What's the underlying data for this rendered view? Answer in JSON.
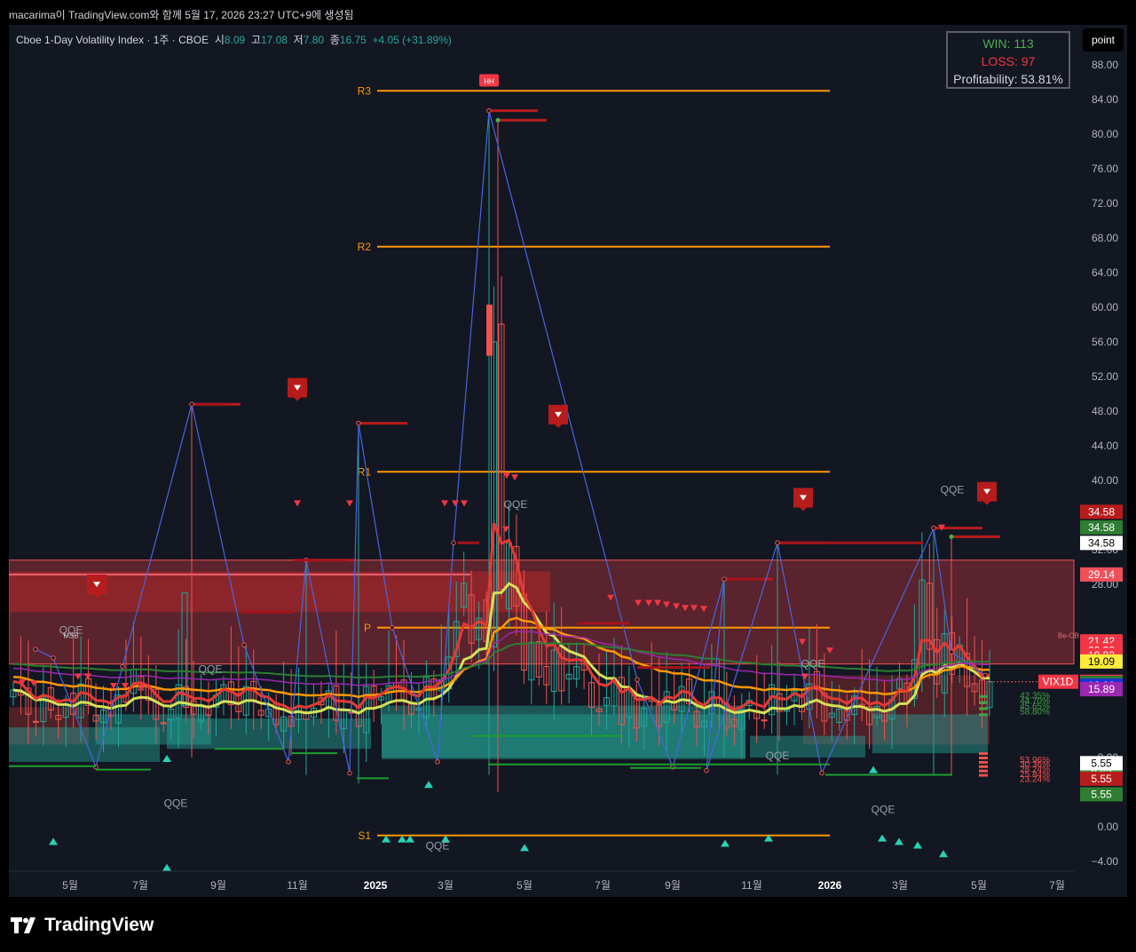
{
  "header": {
    "snapshot_text": "macarima이 TradingView.com와 함께 5월 17, 2026 23:27 UTC+9에 생성됨"
  },
  "legend": {
    "symbol": "Cboe 1-Day Volatility Index · 1주 · CBOE",
    "open_label": "시",
    "open": "8.09",
    "high_label": "고",
    "high": "17.08",
    "low_label": "저",
    "low": "7.80",
    "close_label": "종",
    "close": "16.75",
    "change": "+4.05 (+31.89%)"
  },
  "stats_box": {
    "win": "WIN: 113",
    "loss": "LOSS: 97",
    "profitability": "Profitability: 53.81%"
  },
  "point_button": "point",
  "footer": {
    "brand": "TradingView"
  },
  "colors": {
    "background": "#131722",
    "up": "#26a69a",
    "down": "#ef5350",
    "pivot": "#ff9800",
    "zone": "#b2333c"
  },
  "chart_data": {
    "type": "candlestick",
    "title": "Cboe 1-Day Volatility Index",
    "interval": "1주",
    "y_ticks": [
      "88.00",
      "84.00",
      "80.00",
      "76.00",
      "72.00",
      "68.00",
      "64.00",
      "60.00",
      "56.00",
      "52.00",
      "48.00",
      "44.00",
      "40.00",
      "32.00",
      "28.00",
      "8.00",
      "0.00",
      "−4.00"
    ],
    "y_range": [
      -4.5,
      94
    ],
    "x_ticks": [
      "5월",
      "7월",
      "9월",
      "11월",
      "2025",
      "3월",
      "5월",
      "7월",
      "9월",
      "11월",
      "2026",
      "3월",
      "5월",
      "7월"
    ],
    "pivot_levels": [
      {
        "label": "R3",
        "value": 85.0
      },
      {
        "label": "R2",
        "value": 67.0
      },
      {
        "label": "R1",
        "value": 41.0
      },
      {
        "label": "P",
        "value": 23.0
      },
      {
        "label": "S1",
        "value": -1.0
      }
    ],
    "price_badges": [
      {
        "text": "34.58",
        "bg": "#b71c1c",
        "fg": "#ffffff"
      },
      {
        "text": "34.58",
        "bg": "#2e7d32",
        "fg": "#ffffff"
      },
      {
        "text": "34.58",
        "bg": "#ffffff",
        "fg": "#000000"
      },
      {
        "text": "29.14",
        "bg": "#f0505a",
        "fg": "#ffffff"
      },
      {
        "text": "21.42",
        "bg": "#f23645",
        "fg": "#ffffff"
      },
      {
        "text": "20.38",
        "bg": "#f23645",
        "fg": "#ffffff"
      },
      {
        "text": "19.82",
        "bg": "#f23645",
        "fg": "#ffffff"
      },
      {
        "text": "19.09",
        "bg": "#ffeb3b",
        "fg": "#000000"
      },
      {
        "text": "16.75",
        "bg": "#f23645",
        "fg": "#ffffff"
      },
      {
        "text": "16.62",
        "bg": "#2e7d32",
        "fg": "#ffffff"
      },
      {
        "text": "16.30",
        "bg": "#1e33d6",
        "fg": "#ffffff"
      },
      {
        "text": "15.89",
        "bg": "#9c27b0",
        "fg": "#ffffff"
      },
      {
        "text": "6.45",
        "bg": "#43a047",
        "fg": "#ffffff"
      },
      {
        "text": "5.55",
        "bg": "#ffffff",
        "fg": "#000000"
      },
      {
        "text": "5.55",
        "bg": "#b71c1c",
        "fg": "#ffffff"
      },
      {
        "text": "5.55",
        "bg": "#2e7d32",
        "fg": "#ffffff"
      }
    ],
    "vix_label": "VIX1D",
    "qqe_labels": [
      {
        "text": "QQE",
        "x": 70,
        "v": 22.3
      },
      {
        "text": "QQE",
        "x": 227,
        "v": 17.8
      },
      {
        "text": "QQE",
        "x": 188,
        "v": 2.3
      },
      {
        "text": "QQE",
        "x": 483,
        "v": -2.6
      },
      {
        "text": "QQE",
        "x": 571,
        "v": 36.8
      },
      {
        "text": "QQE",
        "x": 906,
        "v": 18.4
      },
      {
        "text": "QQE",
        "x": 866,
        "v": 7.8
      },
      {
        "text": "QQE",
        "x": 985,
        "v": 1.6
      },
      {
        "text": "QQE",
        "x": 1063,
        "v": 38.5
      }
    ],
    "small_labels": [
      {
        "text": "MSB",
        "x": 70,
        "v": 21.8
      },
      {
        "text": "HH",
        "x": 541,
        "v": 86.0
      },
      {
        "text": "Be-OB",
        "x": 1194,
        "v": 21.8
      }
    ],
    "pct_labels": [
      "42.35%",
      "44.70%",
      "45.65%",
      "58.80%",
      "53.96%",
      "30.36%",
      "28.24%",
      "25.84%",
      "23.24%"
    ],
    "close": [
      15.8,
      15.2,
      13.0,
      12.1,
      15.0,
      13.5,
      12.4,
      14.2,
      13.0,
      16.5,
      14.0,
      12.2,
      13.5,
      12.8,
      15.2,
      14.4,
      18.2,
      15.8,
      14.6,
      12.4,
      11.9,
      13.6,
      16.4,
      13.8,
      13.0,
      13.9,
      12.9,
      15.2,
      16.4,
      14.1,
      13.3,
      16.2,
      14.6,
      12.9,
      13.6,
      11.8,
      12.7,
      11.6,
      13.8,
      12.4,
      13.7,
      14.1,
      15.7,
      12.3,
      13.4,
      13.2,
      11.6,
      16.2,
      13.7,
      15.0,
      16.3,
      15.6,
      14.6,
      13.0,
      13.7,
      17.3,
      14.9,
      17.0,
      19.6,
      23.7,
      28.1,
      21.2,
      24.1,
      21.4,
      56.0,
      27.4,
      32.8,
      25.5,
      18.1,
      21.3,
      17.3,
      16.4,
      20.4,
      15.7,
      17.6,
      18.5,
      18.1,
      13.8,
      13.3,
      14.9,
      17.2,
      11.8,
      15.8,
      11.4,
      13.7,
      14.5,
      11.6,
      15.6,
      13.5,
      16.2,
      14.2,
      11.5,
      12.2,
      15.6,
      13.9,
      11.4,
      11.6,
      13.5,
      14.6,
      12.5,
      12.3,
      16.4,
      13.3,
      13.6,
      15.7,
      13.3,
      16.5,
      15.9,
      12.2,
      13.1,
      13.6,
      12.3,
      15.1,
      13.8,
      11.8,
      13.9,
      12.2,
      14.7,
      17.1,
      14.3,
      19.3,
      28.5,
      20.5,
      16.5,
      22.3,
      17.6,
      21.0,
      16.2,
      15.6,
      14.2,
      16.75
    ]
  }
}
